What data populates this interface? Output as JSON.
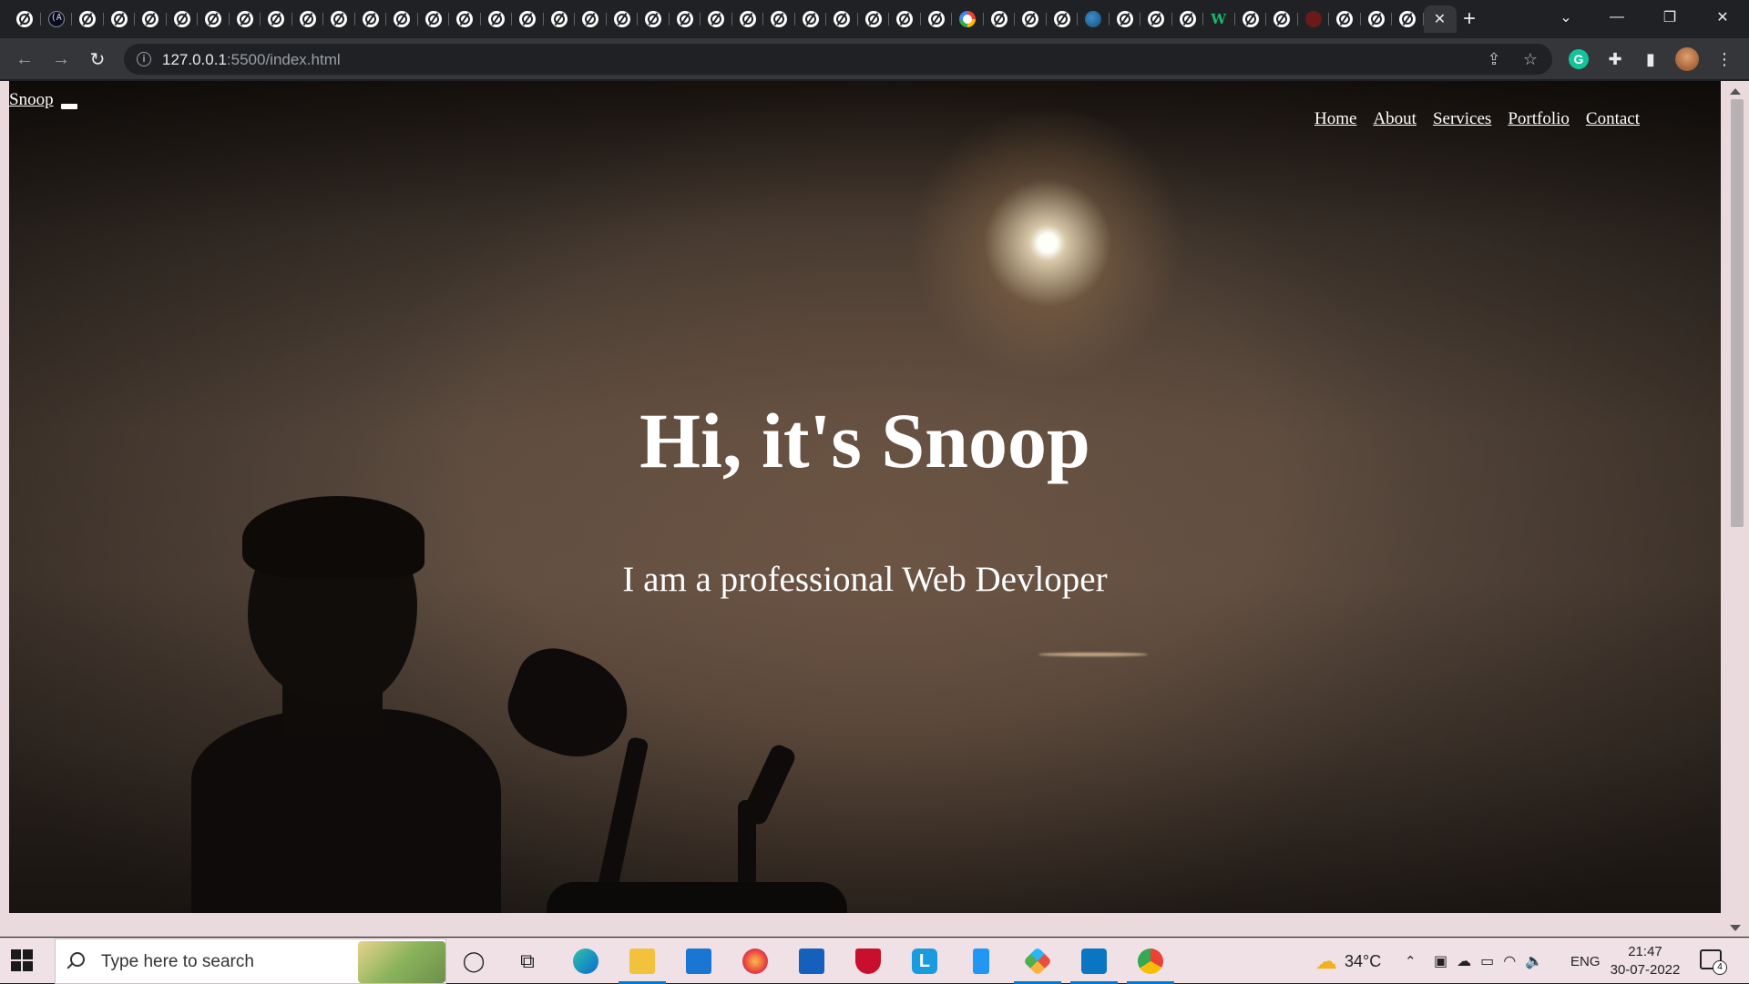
{
  "browser": {
    "tabs": [
      {
        "icon": "web-icon"
      },
      {
        "icon": "freecodecamp-icon",
        "glyph": "(A)"
      },
      {
        "icon": "web-icon"
      },
      {
        "icon": "web-icon"
      },
      {
        "icon": "web-icon"
      },
      {
        "icon": "web-icon"
      },
      {
        "icon": "web-icon"
      },
      {
        "icon": "web-icon"
      },
      {
        "icon": "web-icon"
      },
      {
        "icon": "web-icon"
      },
      {
        "icon": "web-icon"
      },
      {
        "icon": "web-icon"
      },
      {
        "icon": "web-icon"
      },
      {
        "icon": "web-icon"
      },
      {
        "icon": "web-icon"
      },
      {
        "icon": "web-icon"
      },
      {
        "icon": "web-icon"
      },
      {
        "icon": "web-icon"
      },
      {
        "icon": "web-icon"
      },
      {
        "icon": "web-icon"
      },
      {
        "icon": "web-icon"
      },
      {
        "icon": "web-icon"
      },
      {
        "icon": "web-icon"
      },
      {
        "icon": "web-icon"
      },
      {
        "icon": "web-icon"
      },
      {
        "icon": "web-icon"
      },
      {
        "icon": "web-icon"
      },
      {
        "icon": "web-icon"
      },
      {
        "icon": "web-icon"
      },
      {
        "icon": "web-icon"
      },
      {
        "icon": "google-icon"
      },
      {
        "icon": "web-icon"
      },
      {
        "icon": "web-icon"
      },
      {
        "icon": "web-icon"
      },
      {
        "icon": "globe-icon"
      },
      {
        "icon": "web-icon"
      },
      {
        "icon": "web-icon"
      },
      {
        "icon": "web-icon"
      },
      {
        "icon": "w-icon",
        "glyph": "W"
      },
      {
        "icon": "web-icon"
      },
      {
        "icon": "web-icon"
      },
      {
        "icon": "red-circle-icon"
      },
      {
        "icon": "web-icon"
      },
      {
        "icon": "web-icon"
      },
      {
        "icon": "web-icon"
      }
    ],
    "active_tab_close": "✕",
    "new_tab": "+",
    "address_bar": {
      "url_host": "127.0.0.1",
      "url_rest": ":5500/index.html"
    }
  },
  "site": {
    "logo": "Snoop",
    "nav": [
      "Home",
      "About",
      "Services",
      "Portfolio",
      "Contact"
    ],
    "headline": "Hi, it's Snoop",
    "tagline": "I am a professional Web Devloper"
  },
  "taskbar": {
    "search_placeholder": "Type here to search",
    "weather_temp": "34°C",
    "language": "ENG",
    "time": "21:47",
    "date": "30-07-2022",
    "notifications_count": "4"
  },
  "colors": {
    "browser_frame": "#202124",
    "toolbar": "#35363a",
    "taskbar": "#efe1e6",
    "accent": "#0078d4"
  }
}
